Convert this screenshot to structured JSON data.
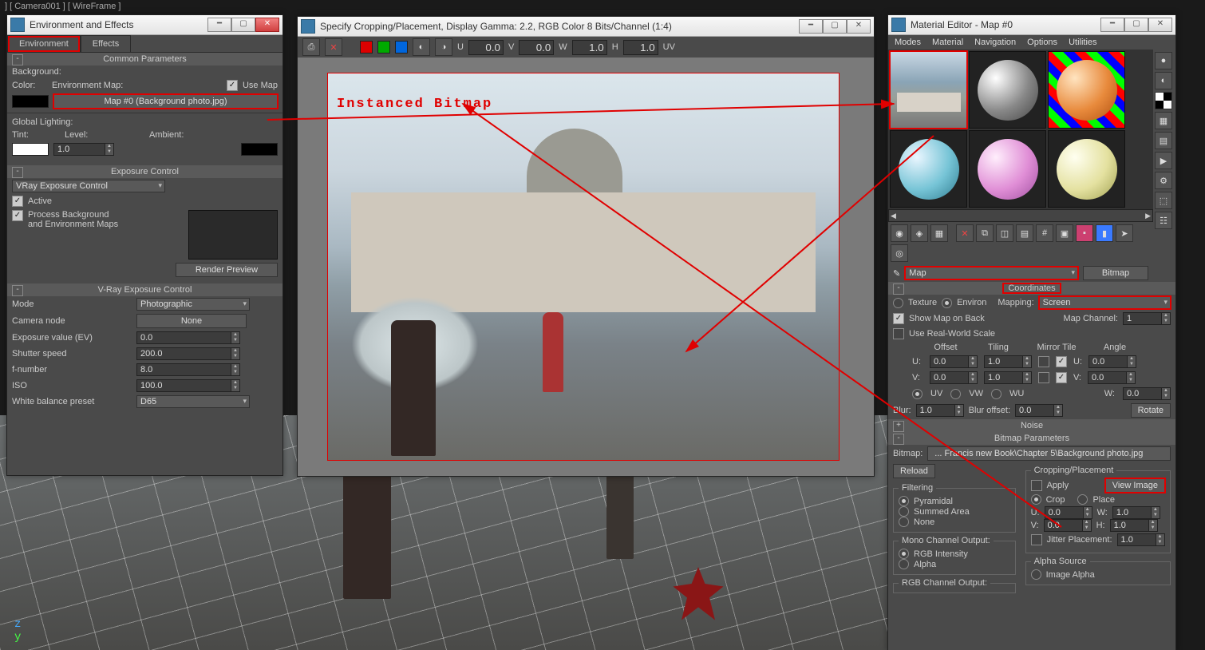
{
  "viewport_label": "] [ Camera001 ] [ WireFrame ]",
  "env_win": {
    "title": "Environment and Effects",
    "tabs": [
      "Environment",
      "Effects"
    ],
    "common_params_title": "Common Parameters",
    "background_label": "Background:",
    "color_label": "Color:",
    "env_map_label": "Environment Map:",
    "use_map_label": "Use Map",
    "use_map_checked": true,
    "env_map_button": "Map #0 (Background photo.jpg)",
    "global_lighting_label": "Global Lighting:",
    "tint_label": "Tint:",
    "level_label": "Level:",
    "level_value": "1.0",
    "ambient_label": "Ambient:",
    "exposure_control_title": "Exposure Control",
    "exposure_plugin": "VRay Exposure Control",
    "active_label": "Active",
    "active_checked": true,
    "process_bg_label1": "Process Background",
    "process_bg_label2": "and Environment Maps",
    "process_bg_checked": true,
    "render_preview": "Render Preview",
    "vray_exposure_title": "V-Ray Exposure Control",
    "mode_label": "Mode",
    "mode_value": "Photographic",
    "camera_node_label": "Camera node",
    "camera_node_value": "None",
    "ev_label": "Exposure value (EV)",
    "ev_value": "0.0",
    "shutter_label": "Shutter speed",
    "shutter_value": "200.0",
    "fnum_label": "f-number",
    "fnum_value": "8.0",
    "iso_label": "ISO",
    "iso_value": "100.0",
    "wb_label": "White balance preset",
    "wb_value": "D65"
  },
  "crop_win": {
    "title": "Specify Cropping/Placement, Display Gamma: 2.2, RGB Color 8 Bits/Channel (1:4)",
    "u_label": "U",
    "u_val": "0.0",
    "v_label": "V",
    "v_val": "0.0",
    "w_label": "W",
    "w_val": "1.0",
    "h_label": "H",
    "h_val": "1.0",
    "uv_label": "UV",
    "instanced_label": "Instanced Bitmap"
  },
  "mat_win": {
    "title": "Material Editor - Map #0",
    "menus": [
      "Modes",
      "Material",
      "Navigation",
      "Options",
      "Utilities"
    ],
    "name_field_label": "Map",
    "type_button": "Bitmap",
    "coordinates_title": "Coordinates",
    "texture_label": "Texture",
    "environ_label": "Environ",
    "environ_on": true,
    "mapping_label": "Mapping:",
    "mapping_value": "Screen",
    "show_map_label": "Show Map on Back",
    "show_map_checked": true,
    "map_channel_label": "Map Channel:",
    "map_channel_value": "1",
    "use_rw_label": "Use Real-World Scale",
    "use_rw_checked": false,
    "col_offset": "Offset",
    "col_tiling": "Tiling",
    "col_mirror": "Mirror",
    "col_tile": "Tile",
    "col_angle": "Angle",
    "u_label": "U:",
    "u_off": "0.0",
    "u_til": "1.0",
    "u_mir": false,
    "u_tile": true,
    "u_ang": "0.0",
    "v_label": "V:",
    "v_off": "0.0",
    "v_til": "1.0",
    "v_mir": false,
    "v_tile": true,
    "v_ang": "0.0",
    "w_label": "W:",
    "w_ang": "0.0",
    "uv_radio": "UV",
    "uv_on": true,
    "vw_radio": "VW",
    "wu_radio": "WU",
    "blur_label": "Blur:",
    "blur_val": "1.0",
    "bluroff_label": "Blur offset:",
    "bluroff_val": "0.0",
    "rotate_btn": "Rotate",
    "noise_title": "Noise",
    "bitmap_params_title": "Bitmap Parameters",
    "bitmap_label": "Bitmap:",
    "bitmap_path": "... Francis new Book\\Chapter 5\\Background photo.jpg",
    "reload_btn": "Reload",
    "cropplace_title": "Cropping/Placement",
    "apply_label": "Apply",
    "apply_checked": false,
    "view_image_btn": "View Image",
    "crop_label": "Crop",
    "crop_on": true,
    "place_label": "Place",
    "cp_u": "U:",
    "cp_u_val": "0.0",
    "cp_w": "W:",
    "cp_w_val": "1.0",
    "cp_v": "V:",
    "cp_v_val": "0.0",
    "cp_h": "H:",
    "cp_h_val": "1.0",
    "jitter_label": "Jitter Placement:",
    "jitter_val": "1.0",
    "filtering_title": "Filtering",
    "filt_pyr": "Pyramidal",
    "filt_pyr_on": true,
    "filt_sum": "Summed Area",
    "filt_none": "None",
    "mono_title": "Mono Channel Output:",
    "mono_rgb": "RGB Intensity",
    "mono_rgb_on": true,
    "mono_alpha": "Alpha",
    "rgb_out_title": "RGB Channel Output:",
    "alpha_src_title": "Alpha Source",
    "alpha_img": "Image Alpha"
  }
}
